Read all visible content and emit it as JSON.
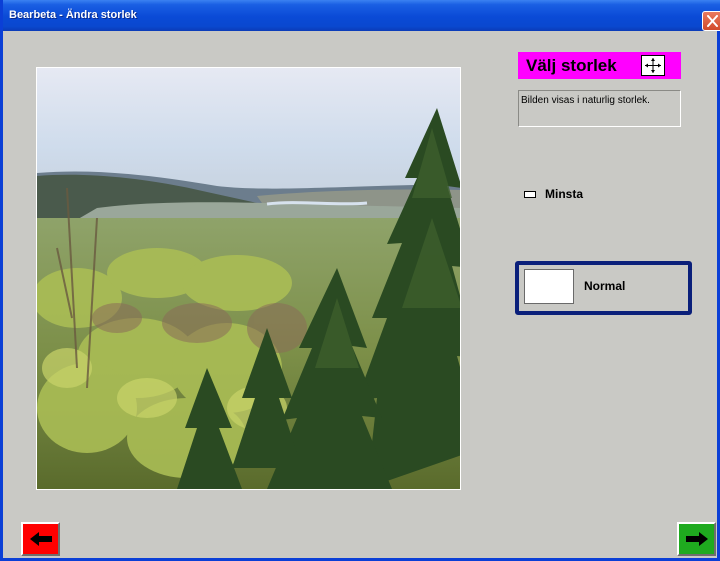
{
  "window": {
    "title": "Bearbeta - Ändra storlek",
    "close_icon": "close-icon",
    "titlebar_color": "#0a4ad6",
    "close_color": "#d24a2a"
  },
  "photo": {
    "description_icon": "landscape-photo",
    "alt": ""
  },
  "size_panel": {
    "heading": "Välj storlek",
    "heading_bg": "#ff00ff",
    "heading_icon": "move-arrows-icon",
    "info": "Bilden visas i naturlig storlek.",
    "options": [
      {
        "label": "Minsta",
        "selected": false
      },
      {
        "label": "Normal",
        "selected": true
      }
    ],
    "selection_color": "#0a1f7a"
  },
  "nav": {
    "back_icon": "arrow-left-icon",
    "back_color": "#ff0000",
    "next_icon": "arrow-right-icon",
    "next_color": "#1faa1f"
  }
}
